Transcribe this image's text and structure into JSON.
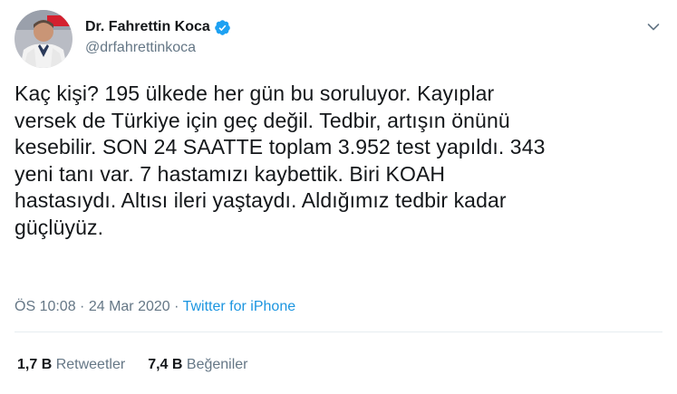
{
  "author": {
    "display_name": "Dr. Fahrettin Koca",
    "handle": "@drfahrettinkoca",
    "verified": true,
    "avatar_icon": "profile-photo"
  },
  "tweet": {
    "lines": [
      "Kaç kişi? 195 ülkede her gün bu soruluyor. Kayıplar",
      "versek de Türkiye için geç değil. Tedbir, artışın önünü",
      "kesebilir. SON 24 SAATTE toplam 3.952 test yapıldı. 343",
      "yeni tanı var. 7 hastamızı kaybettik. Biri KOAH",
      "hastasıydı. Altısı ileri yaştaydı. Aldığımız tedbir kadar",
      "güçlüyüz."
    ]
  },
  "meta": {
    "time": "ÖS 10:08",
    "separator1": " · ",
    "date": "24 Mar 2020",
    "separator2": " · ",
    "source": "Twitter for iPhone"
  },
  "stats": {
    "retweets_count": "1,7 B",
    "retweets_label": "Retweetler",
    "likes_count": "7,4 B",
    "likes_label": "Beğeniler"
  },
  "colors": {
    "text": "#14171a",
    "secondary": "#657786",
    "link": "#1b95e0",
    "verified": "#1da1f2",
    "divider": "#e6ecf0"
  }
}
